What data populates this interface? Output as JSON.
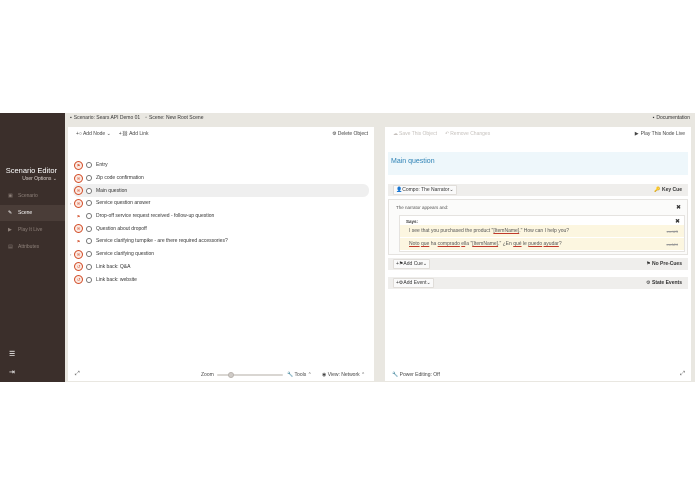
{
  "sidebar": {
    "title": "Scenario Editor",
    "user_options": "User Options",
    "items": [
      {
        "label": "Scenario",
        "icon": "scenario-icon"
      },
      {
        "label": "Scene",
        "icon": "pencil-icon"
      },
      {
        "label": "Play It Live",
        "icon": "play-icon"
      },
      {
        "label": "Attributes",
        "icon": "attributes-icon"
      }
    ]
  },
  "topbar": {
    "scenario": "Scenario: Sears API Demo 01",
    "scene": "Scene: New Root Scene",
    "documentation": "Documentation"
  },
  "left_panel": {
    "add_node": "Add Node",
    "add_link": "Add Link",
    "delete_object": "Delete Object",
    "nodes": [
      {
        "label": "Entry"
      },
      {
        "label": "Zip code confirmation"
      },
      {
        "label": "Main question"
      },
      {
        "label": "Service question answer"
      },
      {
        "label": "Drop-off service request received - follow-up question"
      },
      {
        "label": "Question about dropoff"
      },
      {
        "label": "Service clarifying turnpike - are there required accessories?"
      },
      {
        "label": "Service clarifying question"
      },
      {
        "label": "Link back: Q&A"
      },
      {
        "label": "Link back: website"
      }
    ],
    "zoom_label": "Zoom",
    "zoom_level": 0.18,
    "tools": "Tools",
    "view": "View: Network"
  },
  "right_panel": {
    "save": "Save This Object",
    "remove": "Remove Changes",
    "play": "Play This Node Live",
    "heading": "Main question",
    "compo": "Compo: The Narrator",
    "key_cue": "Key Cue",
    "appears": "The narrator appears and:",
    "says": "Says:",
    "line_en": {
      "pre": "I see that you purchased the product \"",
      "var": "[ItemName]",
      "post": ".\" How can I help you?",
      "lang": "en-US"
    },
    "line_es": {
      "w1": "Noto",
      "w2": "que",
      "w3": "ha",
      "w4": "comprado",
      "w5": "el",
      "w6": "la \"",
      "var": "[ItemName]",
      "w7": ".\" ¿En",
      "w8": "qué",
      "w9": "le",
      "w10": "puedo",
      "w11": "ayudar",
      "w12": "?",
      "lang": "es-MX"
    },
    "add_cue": "Add Cue",
    "no_precues": "No Pre-Cues",
    "add_event": "Add Event",
    "state_events": "State Events",
    "power_editing": "Power Editing: Off"
  }
}
